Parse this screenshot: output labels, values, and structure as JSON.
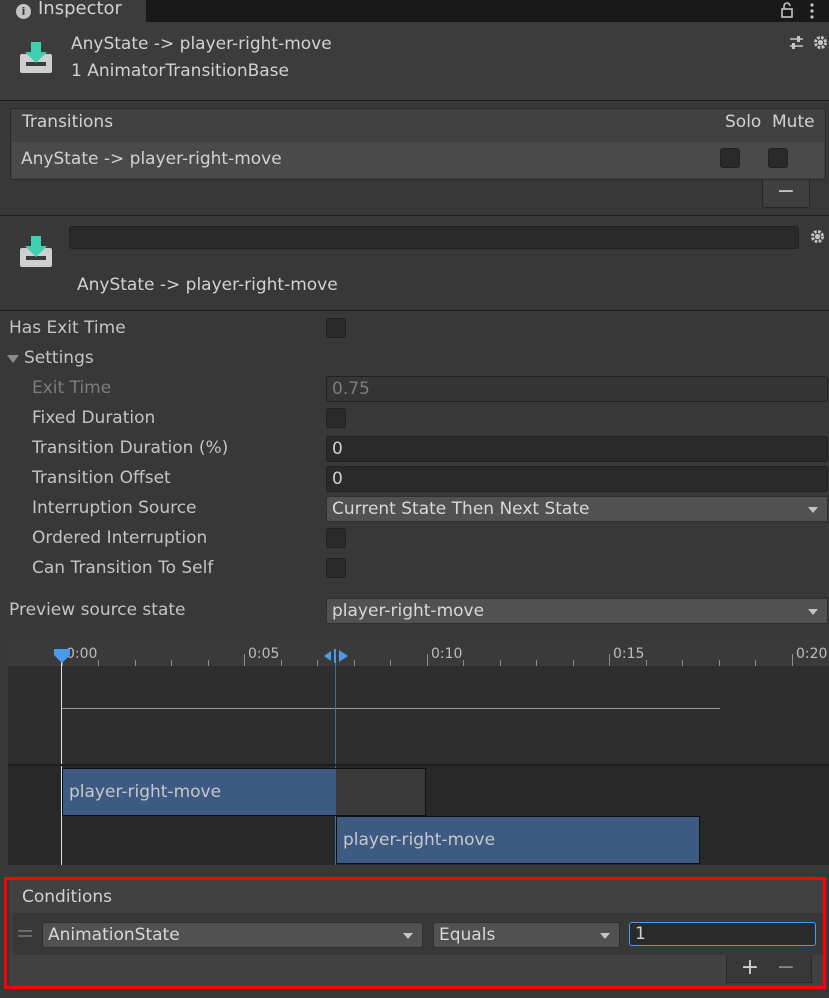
{
  "tab": {
    "title": "Inspector",
    "info_glyph": "i"
  },
  "header": {
    "title": "AnyState -> player-right-move",
    "subtitle": "1 AnimatorTransitionBase"
  },
  "transitions": {
    "header": "Transitions",
    "solo_label": "Solo",
    "mute_label": "Mute",
    "row_label": "AnyState -> player-right-move",
    "solo_checked": false,
    "mute_checked": false,
    "remove_label": "−"
  },
  "transition_detail": {
    "name_value": "",
    "label": "AnyState -> player-right-move"
  },
  "properties": {
    "has_exit_time_label": "Has Exit Time",
    "settings_label": "Settings",
    "exit_time_label": "Exit Time",
    "exit_time_value": "0.75",
    "fixed_duration_label": "Fixed Duration",
    "transition_duration_label": "Transition Duration (%)",
    "transition_duration_value": "0",
    "transition_offset_label": "Transition Offset",
    "transition_offset_value": "0",
    "interruption_source_label": "Interruption Source",
    "interruption_source_value": "Current State Then Next State",
    "ordered_interruption_label": "Ordered Interruption",
    "can_transition_label": "Can Transition To Self",
    "preview_source_label": "Preview source state",
    "preview_source_value": "player-right-move"
  },
  "timeline": {
    "ticks": [
      "0:00",
      "0:05",
      "0:10",
      "0:15",
      "0:20"
    ],
    "clip_a": "player-right-move",
    "clip_b": "player-right-move"
  },
  "conditions": {
    "header": "Conditions",
    "parameter": "AnimationState",
    "operator": "Equals",
    "value": "1",
    "add_label": "+",
    "remove_label": "−"
  },
  "colors": {
    "highlight_outline": "#ff0000",
    "clip_blue": "#3d5a82",
    "accent": "#4a9bef"
  }
}
